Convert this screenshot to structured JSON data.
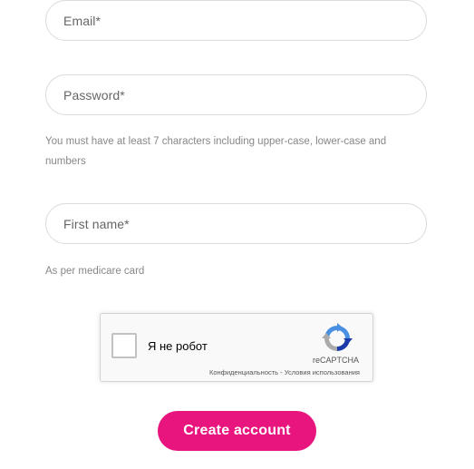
{
  "form": {
    "email": {
      "placeholder": "Email*"
    },
    "password": {
      "placeholder": "Password*",
      "hint": "You must have at least 7 characters including upper-case, lower-case and numbers"
    },
    "first_name": {
      "placeholder": "First name*",
      "hint": "As per medicare card"
    },
    "submit_label": "Create account"
  },
  "recaptcha": {
    "label": "Я не робот",
    "brand": "reCAPTCHA",
    "privacy": "Конфиденциальность",
    "separator": " - ",
    "terms": "Условия использования",
    "logo_icon": "recaptcha-logo-icon"
  },
  "colors": {
    "accent": "#e8157f",
    "field_border": "#dcdcdc",
    "hint_text": "#888888"
  }
}
